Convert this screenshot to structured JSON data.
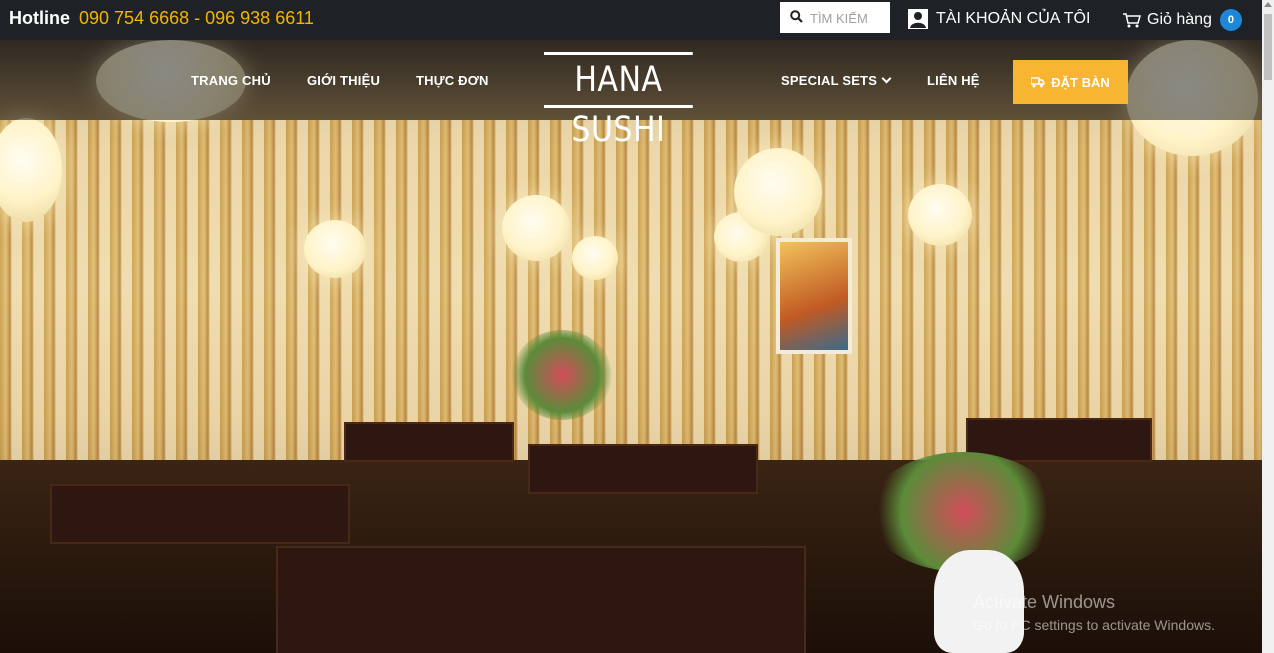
{
  "topbar": {
    "hotline_label": "Hotline",
    "hotline_numbers": "090 754 6668 - 096 938 6611",
    "search_placeholder": "TÌM KIẾM",
    "account_label": "TÀI KHOẢN CỦA TÔI",
    "cart_label": "Giỏ hàng",
    "cart_count": "0"
  },
  "nav": {
    "items": [
      {
        "label": "TRANG CHỦ"
      },
      {
        "label": "GIỚI THIỆU"
      },
      {
        "label": "THỰC ĐƠN"
      },
      {
        "label": "SPECIAL SETS"
      },
      {
        "label": "LIÊN HỆ"
      }
    ],
    "logo_text": "HANA SUSHI",
    "book_button": "ĐẶT BÀN"
  },
  "watermark": {
    "line1": "Activate Windows",
    "line2": "Go to PC settings to activate Windows."
  },
  "colors": {
    "accent": "#f4b400",
    "book_button": "#f7b532",
    "badge": "#1f88d6",
    "topbar_bg": "#1e2125"
  },
  "icons": {
    "search": "search-icon",
    "account": "user-icon",
    "cart": "cart-icon",
    "truck": "truck-icon",
    "dropdown": "chevron-down-icon"
  }
}
